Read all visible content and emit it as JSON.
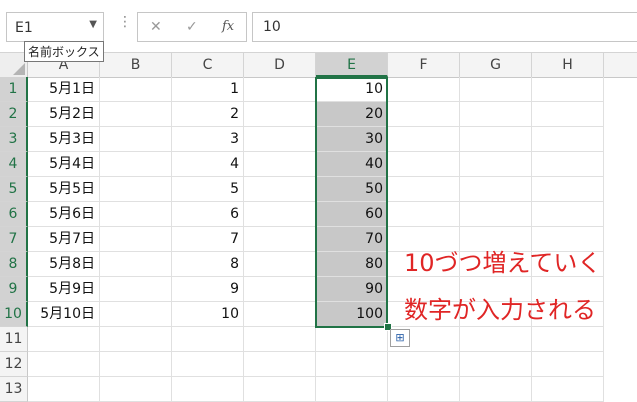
{
  "formula_bar": {
    "name_box": "E1",
    "name_box_tooltip": "名前ボックス",
    "menu_dots": "⋮",
    "cancel_glyph": "✕",
    "enter_glyph": "✓",
    "fx_glyph": "fx",
    "formula_value": "10"
  },
  "columns": [
    "A",
    "B",
    "C",
    "D",
    "E",
    "F",
    "G",
    "H"
  ],
  "rows": [
    "1",
    "2",
    "3",
    "4",
    "5",
    "6",
    "7",
    "8",
    "9",
    "10",
    "11",
    "12",
    "13"
  ],
  "data": {
    "A": [
      "5月1日",
      "5月2日",
      "5月3日",
      "5月4日",
      "5月5日",
      "5月6日",
      "5月7日",
      "5月8日",
      "5月9日",
      "5月10日"
    ],
    "C": [
      "1",
      "2",
      "3",
      "4",
      "5",
      "6",
      "7",
      "8",
      "9",
      "10"
    ],
    "E": [
      "10",
      "20",
      "30",
      "40",
      "50",
      "60",
      "70",
      "80",
      "90",
      "100"
    ]
  },
  "selection": {
    "active_cell": "E1",
    "range": "E1:E10"
  },
  "quick_analysis_icon": "quick-analysis-icon",
  "annotation": {
    "line1": "10づつ増えていく",
    "line2": "数字が入力される",
    "color": "#e02525"
  },
  "colors": {
    "selection": "#217346",
    "selected_fill": "#c8c8c8"
  }
}
